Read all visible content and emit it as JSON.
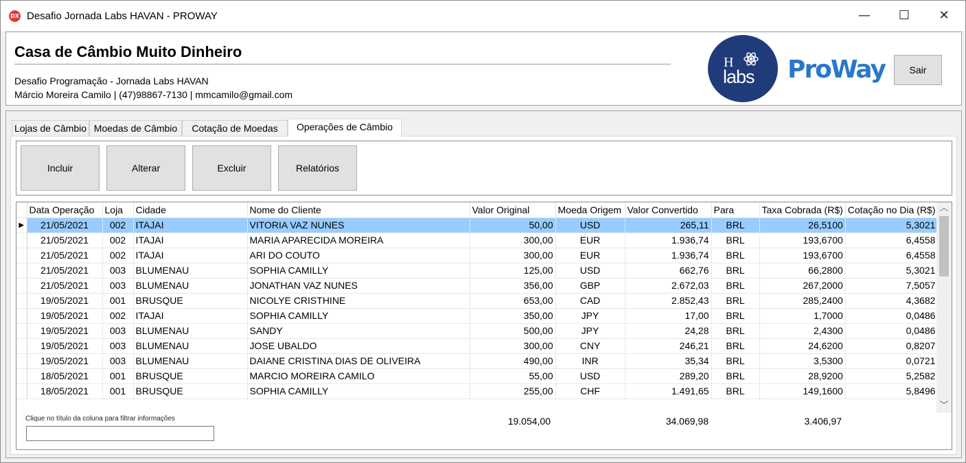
{
  "window": {
    "app_icon_label": "DX",
    "title": "Desafio Jornada Labs HAVAN - PROWAY",
    "minimize_glyph": "—",
    "maximize_glyph": "☐",
    "close_glyph": "✕"
  },
  "header": {
    "title": "Casa de Câmbio Muito Dinheiro",
    "subtitle": "Desafio Programação - Jornada Labs HAVAN",
    "contact": "Márcio Moreira Camilo | (47)98867-7130 | mmcamilo@gmail.com",
    "logo_h": "H",
    "logo_labs": "labs",
    "logo_proway": "ProWay",
    "exit_label": "Sair",
    "colors": {
      "logo_circle": "#1f3b7a",
      "proway": "#2a78c8"
    }
  },
  "tabs": [
    {
      "label": "Lojas de Câmbio"
    },
    {
      "label": "Moedas de Câmbio"
    },
    {
      "label": "Cotação de Moedas"
    },
    {
      "label": "Operações de Câmbio",
      "active": true
    }
  ],
  "toolbar": {
    "include_label": "Incluir",
    "edit_label": "Alterar",
    "delete_label": "Excluir",
    "reports_label": "Relatórios"
  },
  "grid": {
    "selection_color": "#99ccff",
    "current_row_marker": "▶",
    "columns": [
      "Data Operação",
      "Loja",
      "Cidade",
      "Nome do Cliente",
      "Valor Original",
      "Moeda Origem",
      "Valor Convertido",
      "Para",
      "Taxa Cobrada (R$)",
      "Cotação no Dia (R$)"
    ],
    "rows": [
      [
        "21/05/2021",
        "002",
        "ITAJAI",
        "VITORIA VAZ NUNES",
        "50,00",
        "USD",
        "265,11",
        "BRL",
        "26,5100",
        "5,3021"
      ],
      [
        "21/05/2021",
        "002",
        "ITAJAI",
        "MARIA APARECIDA MOREIRA",
        "300,00",
        "EUR",
        "1.936,74",
        "BRL",
        "193,6700",
        "6,4558"
      ],
      [
        "21/05/2021",
        "002",
        "ITAJAI",
        "ARI DO COUTO",
        "300,00",
        "EUR",
        "1.936,74",
        "BRL",
        "193,6700",
        "6,4558"
      ],
      [
        "21/05/2021",
        "003",
        "BLUMENAU",
        "SOPHIA CAMILLY",
        "125,00",
        "USD",
        "662,76",
        "BRL",
        "66,2800",
        "5,3021"
      ],
      [
        "21/05/2021",
        "003",
        "BLUMENAU",
        "JONATHAN VAZ NUNES",
        "356,00",
        "GBP",
        "2.672,03",
        "BRL",
        "267,2000",
        "7,5057"
      ],
      [
        "19/05/2021",
        "001",
        "BRUSQUE",
        "NICOLYE CRISTHINE",
        "653,00",
        "CAD",
        "2.852,43",
        "BRL",
        "285,2400",
        "4,3682"
      ],
      [
        "19/05/2021",
        "002",
        "ITAJAI",
        "SOPHIA CAMILLY",
        "350,00",
        "JPY",
        "17,00",
        "BRL",
        "1,7000",
        "0,0486"
      ],
      [
        "19/05/2021",
        "003",
        "BLUMENAU",
        "SANDY",
        "500,00",
        "JPY",
        "24,28",
        "BRL",
        "2,4300",
        "0,0486"
      ],
      [
        "19/05/2021",
        "003",
        "BLUMENAU",
        "JOSE UBALDO",
        "300,00",
        "CNY",
        "246,21",
        "BRL",
        "24,6200",
        "0,8207"
      ],
      [
        "19/05/2021",
        "003",
        "BLUMENAU",
        "DAIANE CRISTINA DIAS DE OLIVEIRA",
        "490,00",
        "INR",
        "35,34",
        "BRL",
        "3,5300",
        "0,0721"
      ],
      [
        "18/05/2021",
        "001",
        "BRUSQUE",
        "MARCIO MOREIRA CAMILO",
        "55,00",
        "USD",
        "289,20",
        "BRL",
        "28,9200",
        "5,2582"
      ],
      [
        "18/05/2021",
        "001",
        "BRUSQUE",
        "SOPHIA CAMILLY",
        "255,00",
        "CHF",
        "1.491,65",
        "BRL",
        "149,1600",
        "5,8496"
      ]
    ],
    "scroll_up_glyph": "︿",
    "scroll_down_glyph": "﹀"
  },
  "footer": {
    "filter_label": "Clique no título da coluna para filtrar informações",
    "filter_value": "",
    "total_original": "19.054,00",
    "total_converted": "34.069,98",
    "total_fee": "3.406,97"
  }
}
